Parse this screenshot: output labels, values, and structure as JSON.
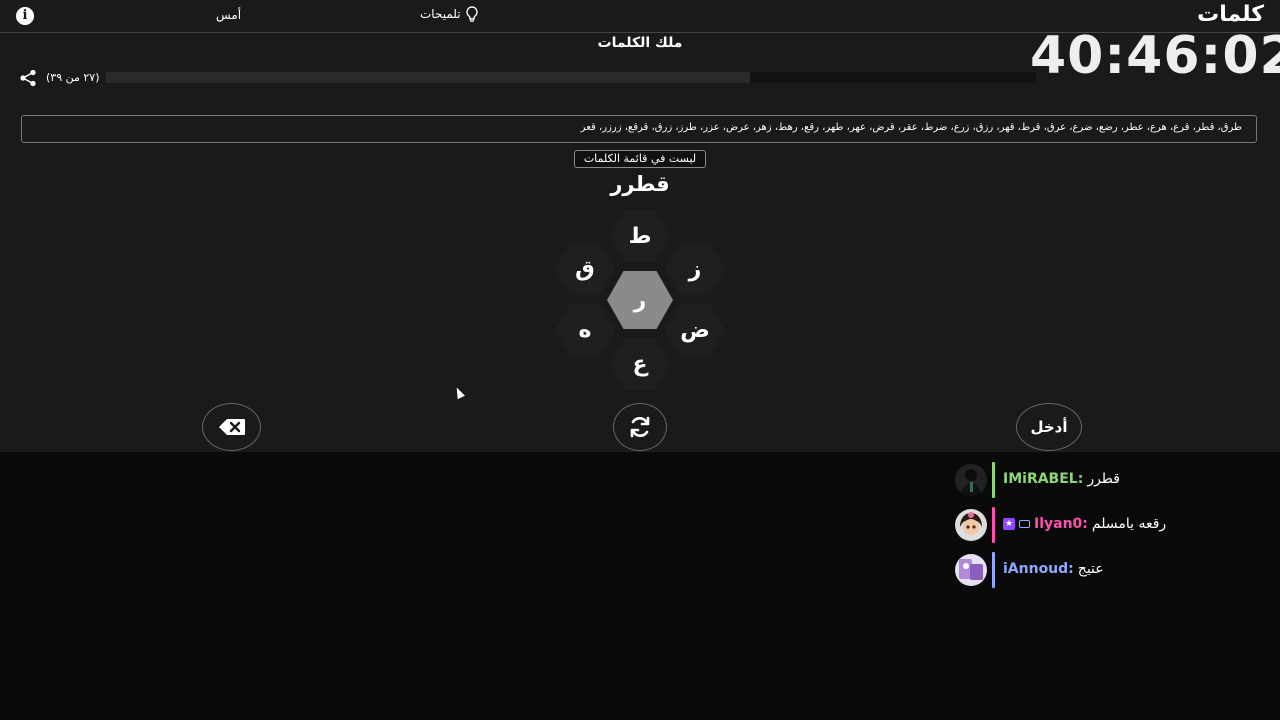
{
  "header": {
    "brand": "كلمات",
    "hints_label": "تلميحات",
    "yesterday_label": "أمس",
    "info_glyph": "i"
  },
  "page_title": "ملك الكلمات",
  "timer": "40:46:02",
  "progress": {
    "text": "(٢٧ من ٣٩)",
    "found": 27,
    "total": 39
  },
  "found_words": "طرق، قطر، قرع، هرع، عطر، رضع، ضرع، عرق، قرط، قهر، رزق، زرع، ضرط، عقر، قرض، عهر، طهر، رقع، رهط، زهر، عرض، عزر، طرز، زرق، قرقع، زرزر، قعر",
  "toast": "ليست في قائمة الكلمات",
  "current_word": "قطرر",
  "letters": {
    "center": "ر",
    "top": "ط",
    "upper_left": "ق",
    "upper_right": "ز",
    "lower_left": "ه",
    "lower_right": "ض",
    "bottom": "ع"
  },
  "buttons": {
    "enter_label": "أدخل"
  },
  "chat": {
    "messages": [
      {
        "user": "IMiRABEL:",
        "text": "قطرر",
        "color": "#8fd67a"
      },
      {
        "user": "Ilyan0:",
        "text": "رقعه يامسلم",
        "color": "#ff4fb0"
      },
      {
        "user": "iAnnoud:",
        "text": "عتيج",
        "color": "#8fa8ff"
      }
    ]
  },
  "colors": {
    "game_bg": "#1a1a1a",
    "page_bg": "#0a0a0a",
    "center_hex": "#8a8a8a",
    "outer_hex": "#1f1f1f"
  }
}
